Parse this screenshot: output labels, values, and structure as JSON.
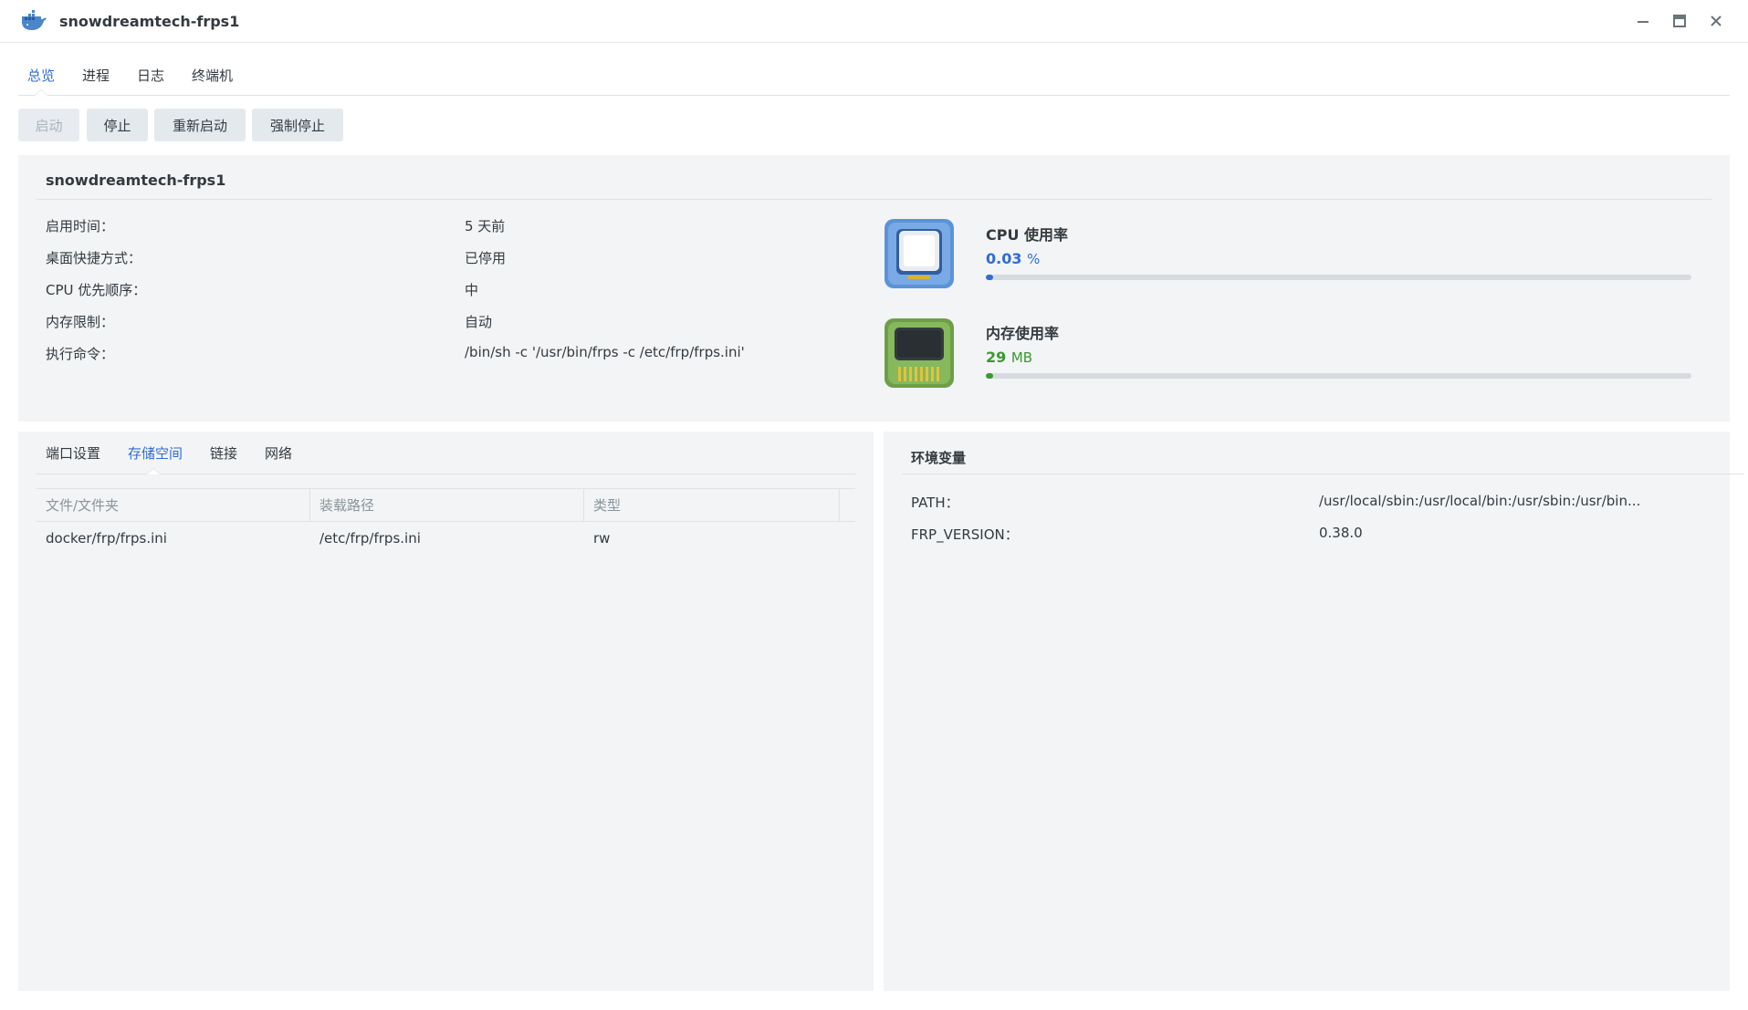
{
  "window": {
    "title": "snowdreamtech-frps1",
    "app_icon": "docker-whale-icon",
    "controls": [
      "minimize-icon",
      "maximize-icon",
      "close-icon"
    ]
  },
  "main_tabs": [
    "总览",
    "进程",
    "日志",
    "终端机"
  ],
  "main_tabs_active": "总览",
  "toolbar": {
    "start_label": "启动",
    "stop_label": "停止",
    "restart_label": "重新启动",
    "force_stop_label": "强制停止"
  },
  "summary": {
    "title": "snowdreamtech-frps1",
    "rows": [
      {
        "label": "启用时间：",
        "value": "5 天前"
      },
      {
        "label": "桌面快捷方式：",
        "value": "已停用"
      },
      {
        "label": "CPU 优先顺序：",
        "value": "中"
      },
      {
        "label": "内存限制：",
        "value": "自动"
      },
      {
        "label": "执行命令：",
        "value": "/bin/sh -c '/usr/bin/frps -c /etc/frp/frps.ini'"
      }
    ],
    "cpu": {
      "title": "CPU 使用率",
      "value": "0.03",
      "unit": "%",
      "percent": 0.03,
      "color": "#2f6cd4",
      "icon": "cpu-chip-icon"
    },
    "memory": {
      "title": "内存使用率",
      "value": "29",
      "unit": "MB",
      "percent": 0.5,
      "color": "#3a9a2e",
      "icon": "memory-module-icon"
    }
  },
  "storage_panel": {
    "tabs": [
      "端口设置",
      "存储空间",
      "链接",
      "网络"
    ],
    "active_tab": "存储空间",
    "columns": [
      "文件/文件夹",
      "装载路径",
      "类型"
    ],
    "rows": [
      [
        "docker/frp/frps.ini",
        "/etc/frp/frps.ini",
        "rw"
      ]
    ]
  },
  "env_panel": {
    "title": "环境变量",
    "vars": [
      {
        "name": "PATH：",
        "value": "/usr/local/sbin:/usr/local/bin:/usr/sbin:/usr/bin..."
      },
      {
        "name": "FRP_VERSION：",
        "value": "0.38.0"
      }
    ]
  },
  "colors": {
    "accent": "#2f6cd4",
    "memory_green": "#3a9a2e",
    "panel_bg": "#f2f4f5"
  }
}
